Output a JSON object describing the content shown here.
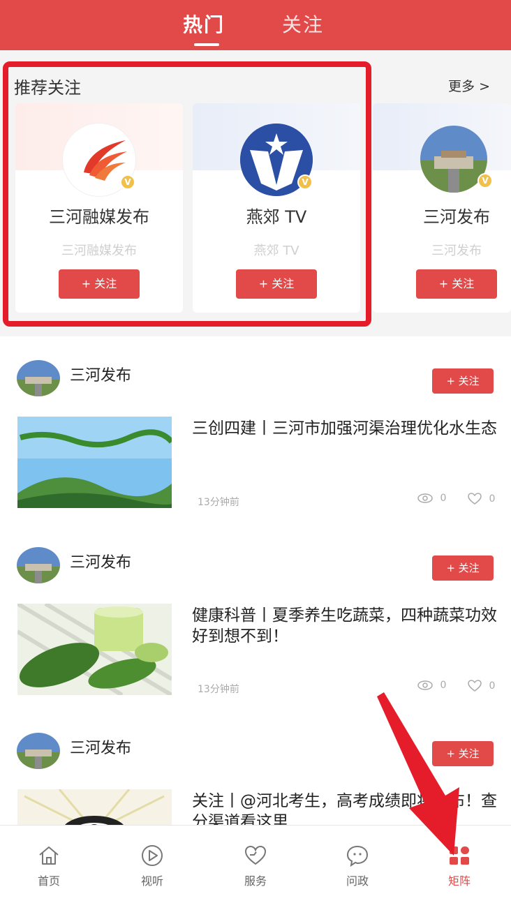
{
  "header": {
    "tabs": [
      "热门",
      "关注"
    ],
    "active_tab": "热门"
  },
  "recommend": {
    "title": "推荐关注",
    "more_label": "更多 >",
    "cards": [
      {
        "name": "三河融媒发布",
        "subtitle": "三河融媒发布",
        "follow_label": "+ 关注",
        "badge": "V"
      },
      {
        "name": "燕郊 TV",
        "subtitle": "燕郊 TV",
        "follow_label": "+ 关注",
        "badge": "V"
      },
      {
        "name": "三河发布",
        "subtitle": "三河发布",
        "follow_label": "+ 关注",
        "badge": "V"
      }
    ]
  },
  "feed": [
    {
      "author": "三河发布",
      "follow_label": "+ 关注",
      "title": "三创四建丨三河市加强河渠治理优化水生态",
      "time": "13分钟前",
      "views": "0",
      "likes": "0"
    },
    {
      "author": "三河发布",
      "follow_label": "+ 关注",
      "title": "健康科普丨夏季养生吃蔬菜，四种蔬菜功效好到想不到！",
      "time": "13分钟前",
      "views": "0",
      "likes": "0"
    },
    {
      "author": "三河发布",
      "follow_label": "+ 关注",
      "title": "关注丨@河北考生，高考成绩即将公布！查分渠道看这里",
      "time": "",
      "views": "",
      "likes": ""
    }
  ],
  "bottom_nav": {
    "items": [
      {
        "label": "首页",
        "icon": "home-icon"
      },
      {
        "label": "视听",
        "icon": "play-icon"
      },
      {
        "label": "服务",
        "icon": "heart-icon"
      },
      {
        "label": "问政",
        "icon": "chat-icon"
      },
      {
        "label": "矩阵",
        "icon": "grid-icon"
      }
    ],
    "active": "矩阵"
  },
  "colors": {
    "brand_red": "#e14a48",
    "highlight_red": "#e51d2a",
    "badge_gold": "#f0c04a"
  }
}
